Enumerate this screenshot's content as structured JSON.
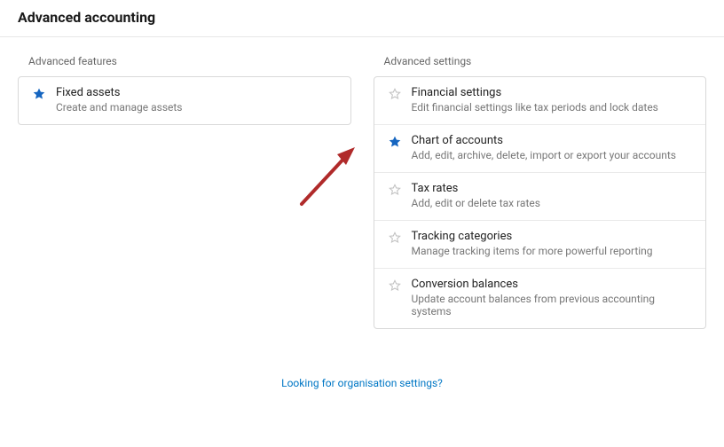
{
  "page": {
    "title": "Advanced accounting",
    "footer_link": "Looking for organisation settings?"
  },
  "features": {
    "label": "Advanced features",
    "items": [
      {
        "title": "Fixed assets",
        "desc": "Create and manage assets",
        "starred": true
      }
    ]
  },
  "settings": {
    "label": "Advanced settings",
    "items": [
      {
        "title": "Financial settings",
        "desc": "Edit financial settings like tax periods and lock dates",
        "starred": false
      },
      {
        "title": "Chart of accounts",
        "desc": "Add, edit, archive, delete, import or export your accounts",
        "starred": true
      },
      {
        "title": "Tax rates",
        "desc": "Add, edit or delete tax rates",
        "starred": false
      },
      {
        "title": "Tracking categories",
        "desc": "Manage tracking items for more powerful reporting",
        "starred": false
      },
      {
        "title": "Conversion balances",
        "desc": "Update account balances from previous accounting systems",
        "starred": false
      }
    ]
  },
  "colors": {
    "star_active": "#1565c0",
    "star_inactive": "#c2c2c2",
    "link": "#0077c5",
    "arrow": "#b02a2a"
  }
}
